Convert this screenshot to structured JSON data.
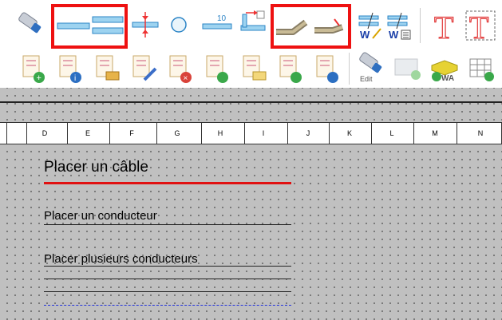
{
  "toolbar_row1": {
    "buttons": [
      {
        "name": "cable-tool-icon"
      },
      {
        "name": "single-line-icon"
      },
      {
        "name": "double-line-icon"
      },
      {
        "name": "line-break-icon"
      },
      {
        "name": "circle-icon"
      },
      {
        "name": "numbered-line-icon",
        "text": "10"
      },
      {
        "name": "jumper-icon"
      },
      {
        "name": "cable-bend-icon"
      },
      {
        "name": "cable-end-icon"
      },
      {
        "name": "wire-number-edit-icon",
        "text": "W"
      },
      {
        "name": "wire-number-list-icon",
        "text": "W"
      },
      {
        "name": "text-icon",
        "text": "T"
      },
      {
        "name": "text-box-icon",
        "text": "T"
      }
    ]
  },
  "toolbar_row2": {
    "buttons": [
      {
        "name": "add-sheet-icon"
      },
      {
        "name": "sheet-info-icon"
      },
      {
        "name": "move-sheet-icon"
      },
      {
        "name": "edit-sheet-icon"
      },
      {
        "name": "delete-sheet-icon"
      },
      {
        "name": "refresh-sheet-icon"
      },
      {
        "name": "sheet-folder-icon"
      },
      {
        "name": "sheet-cycle-icon"
      },
      {
        "name": "sheet-properties-icon"
      },
      {
        "name": "cable-edit-icon",
        "text": "Edit"
      },
      {
        "name": "image-add-icon"
      },
      {
        "name": "wire-assembly-icon",
        "text": "WA"
      },
      {
        "name": "table-add-icon"
      }
    ]
  },
  "ruler": {
    "labels": [
      "D",
      "E",
      "F",
      "G",
      "H",
      "I",
      "J",
      "K",
      "L",
      "M",
      "N"
    ]
  },
  "canvas": {
    "cable_title": "Placer un câble",
    "conductor_title": "Placer un conducteur",
    "multi_title": "Placer plusieurs conducteurs"
  },
  "colors": {
    "highlight": "#e11111",
    "cable_line": "#e01010",
    "dashed_line": "#2233dd",
    "canvas_bg": "#c0c0c0"
  }
}
